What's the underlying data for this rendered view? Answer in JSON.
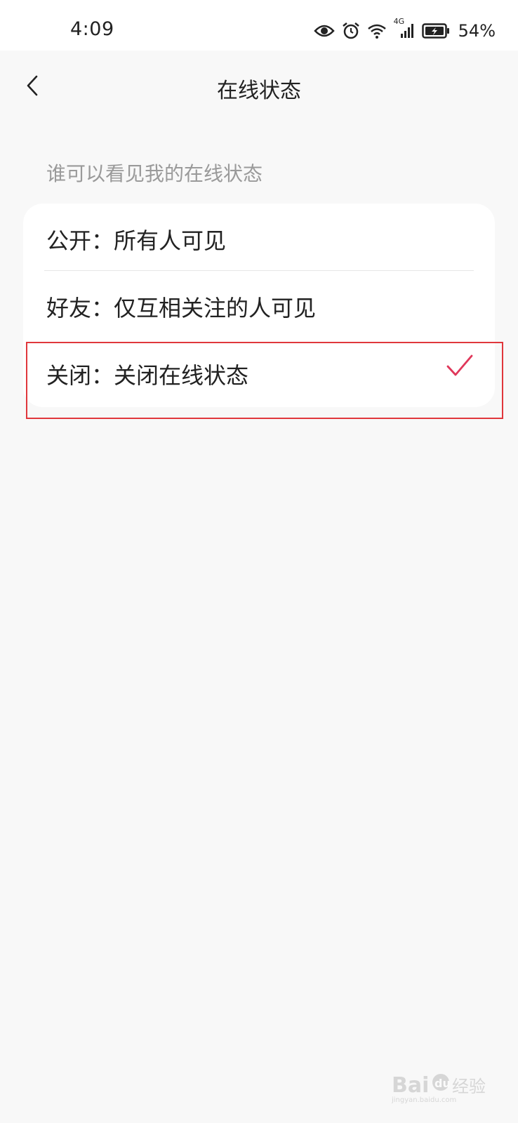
{
  "status_bar": {
    "time": "4:09",
    "network": "4G",
    "battery_percent": "54%",
    "icons": [
      "eye-icon",
      "alarm-icon",
      "wifi-icon",
      "signal-icon",
      "battery-charging-icon"
    ]
  },
  "nav": {
    "title": "在线状态",
    "back_icon": "chevron-left-icon"
  },
  "section": {
    "label": "谁可以看见我的在线状态"
  },
  "options": [
    {
      "label": "公开：所有人可见",
      "selected": false
    },
    {
      "label": "好友：仅互相关注的人可见",
      "selected": false
    },
    {
      "label": "关闭：关闭在线状态",
      "selected": true
    }
  ],
  "colors": {
    "accent": "#e0375a",
    "highlight_border": "#e0373c",
    "background": "#f8f8f8",
    "card": "#ffffff",
    "secondary_text": "#9a9a9a"
  },
  "watermark": {
    "text": "Baidu经验",
    "subtext": "jingyan.baidu.com"
  }
}
